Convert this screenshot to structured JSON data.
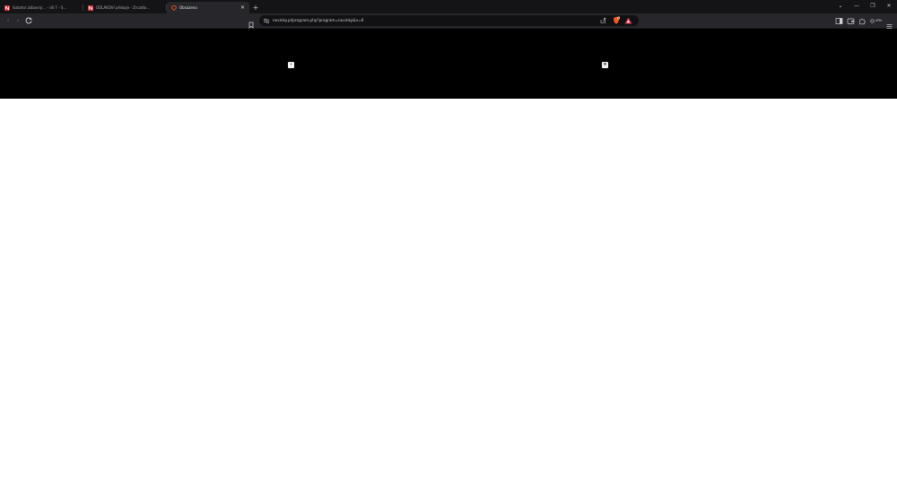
{
  "tabs": [
    {
      "title": "Sobotní zábavný… - díl 7 - S…",
      "favicon": "red-n-icon",
      "active": false
    },
    {
      "title": "ODLÁKOVI přebaje - Zrcadlo…",
      "favicon": "red-n-icon",
      "active": false
    },
    {
      "title": "Obsazeno",
      "favicon": "brave-lion-icon",
      "active": true
    }
  ],
  "toolbar": {
    "url": "novinky.pl/program.php?program=novinky&n=6",
    "vpn_label": "VPN"
  },
  "viewer": {
    "prev_label": "‹",
    "close_label": "×"
  },
  "colors": {
    "tabstrip": "#141416",
    "toolbar": "#27272b",
    "urlbar": "#111113",
    "viewer": "#000000",
    "favicon_red": "#d6313b",
    "brave_orange": "#f65a22"
  }
}
